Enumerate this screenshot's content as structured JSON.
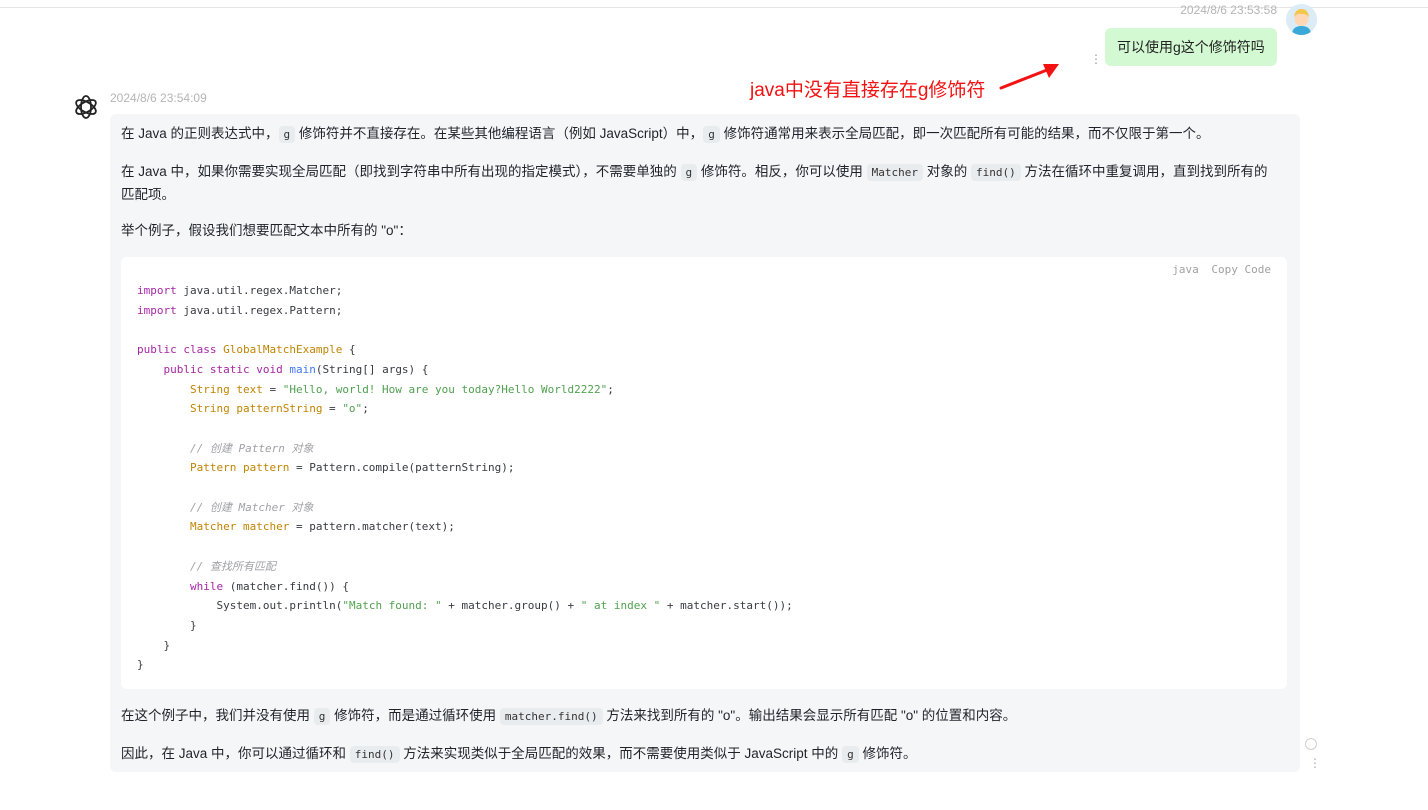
{
  "user_message": {
    "timestamp": "2024/8/6 23:53:58",
    "text": "可以使用g这个修饰符吗",
    "avatar": "user-avatar-image",
    "more_icon": "⋮"
  },
  "annotation": {
    "text": "java中没有直接存在g修饰符",
    "color": "#f31111"
  },
  "assistant_message": {
    "avatar": "openai-logo-icon",
    "timestamp": "2024/8/6 23:54:09",
    "p1": {
      "a": "在 Java 的正则表达式中，",
      "code1": "g",
      "b": " 修饰符并不直接存在。在某些其他编程语言（例如 JavaScript）中，",
      "code2": "g",
      "c": " 修饰符通常用来表示全局匹配，即一次匹配所有可能的结果，而不仅限于第一个。"
    },
    "p2": {
      "a": "在 Java 中，如果你需要实现全局匹配（即找到字符串中所有出现的指定模式），不需要单独的 ",
      "code1": "g",
      "b": " 修饰符。相反，你可以使用 ",
      "code2": "Matcher",
      "c": " 对象的 ",
      "code3": "find()",
      "d": " 方法在循环中重复调用，直到找到所有的匹配项。"
    },
    "p3": "举个例子，假设我们想要匹配文本中所有的 \"o\"：",
    "code_block": {
      "language": "java",
      "copy_label": "Copy Code",
      "lines": {
        "l1": {
          "kw": "import",
          "rest": " java.util.regex.Matcher;"
        },
        "l2": {
          "kw": "import",
          "rest": " java.util.regex.Pattern;"
        },
        "l4": {
          "kw": "public class",
          "name": "GlobalMatchExample",
          "rest": " {"
        },
        "l5": {
          "indent": "    ",
          "kw": "public static void",
          "fn": "main",
          "rest": "(String[] args) {"
        },
        "l6": {
          "indent": "        ",
          "ty": "String text",
          "eq": " = ",
          "str": "\"Hello, world! How are you today?Hello World2222\"",
          "end": ";"
        },
        "l7": {
          "indent": "        ",
          "ty": "String patternString",
          "eq": " = ",
          "str": "\"o\"",
          "end": ";"
        },
        "l9": {
          "indent": "        ",
          "comment": "// 创建 Pattern 对象"
        },
        "l10": {
          "indent": "        ",
          "ty": "Pattern pattern",
          "rest": " = Pattern.compile(patternString);"
        },
        "l12": {
          "indent": "        ",
          "comment": "// 创建 Matcher 对象"
        },
        "l13": {
          "indent": "        ",
          "ty": "Matcher matcher",
          "rest": " = pattern.matcher(text);"
        },
        "l15": {
          "indent": "        ",
          "comment": "// 查找所有匹配"
        },
        "l16": {
          "indent": "        ",
          "kw": "while",
          "rest": " (matcher.find()) {"
        },
        "l17": {
          "indent": "            ",
          "a": "System.out.println(",
          "str1": "\"Match found: \"",
          "b": " + matcher.group() + ",
          "str2": "\" at index \"",
          "c": " + matcher.start());"
        },
        "l18": {
          "text": "        }"
        },
        "l19": {
          "text": "    }"
        },
        "l20": {
          "text": "}"
        }
      }
    },
    "p4": {
      "a": "在这个例子中，我们并没有使用 ",
      "code1": "g",
      "b": " 修饰符，而是通过循环使用 ",
      "code2": "matcher.find()",
      "c": " 方法来找到所有的 \"o\"。输出结果会显示所有匹配 \"o\" 的位置和内容。"
    },
    "p5": {
      "a": "因此，在 Java 中，你可以通过循环和 ",
      "code1": "find()",
      "b": " 方法来实现类似于全局匹配的效果，而不需要使用类似于 JavaScript 中的 ",
      "code2": "g",
      "c": " 修饰符。"
    }
  }
}
